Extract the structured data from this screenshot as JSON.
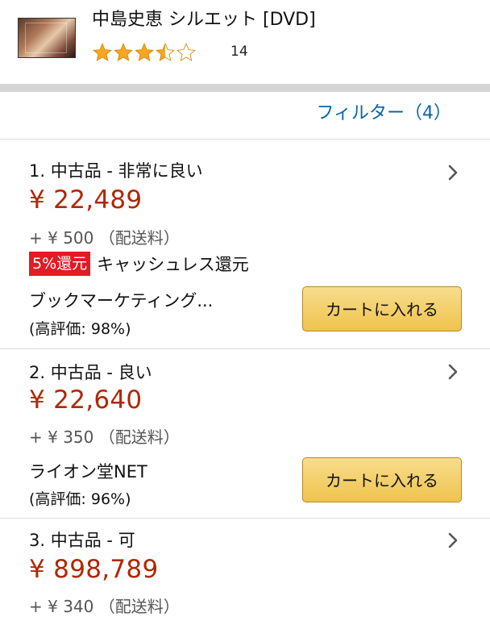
{
  "product": {
    "title": "中島史恵 シルエット [DVD]",
    "rating": 3.5,
    "rating_count": "14"
  },
  "filter": {
    "label": "フィルター（4）"
  },
  "offers": [
    {
      "condition": "1. 中古品 - 非常に良い",
      "price": "¥ 22,489",
      "shipping": "+ ¥ 500 （配送料）",
      "badge": "5%還元",
      "badge_text": "キャッシュレス還元",
      "seller": "ブックマーケティング...",
      "seller_rating": "(高評価: 98%)",
      "button": "カートに入れる"
    },
    {
      "condition": "2. 中古品 - 良い",
      "price": "¥ 22,640",
      "shipping": "+ ¥ 350 （配送料）",
      "seller": "ライオン堂NET",
      "seller_rating": "(高評価: 96%)",
      "button": "カートに入れる"
    },
    {
      "condition": "3. 中古品 - 可",
      "price": "¥ 898,789",
      "shipping": "+ ¥ 340 （配送料）"
    }
  ],
  "colors": {
    "price": "#b12704",
    "link": "#0a66a8",
    "star": "#f5a623",
    "badge": "#e21b24",
    "button": "#f0c34e"
  }
}
